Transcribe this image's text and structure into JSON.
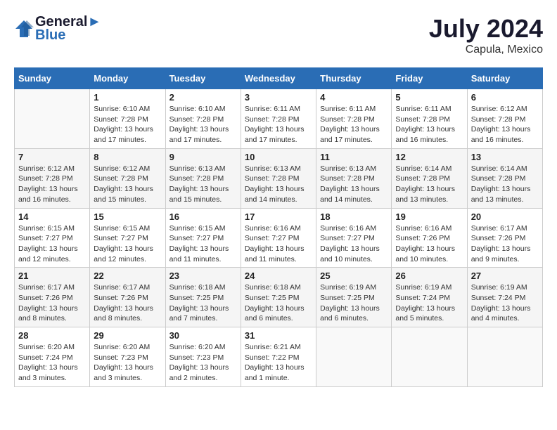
{
  "header": {
    "logo_line1": "General",
    "logo_line2": "Blue",
    "month_year": "July 2024",
    "location": "Capula, Mexico"
  },
  "weekdays": [
    "Sunday",
    "Monday",
    "Tuesday",
    "Wednesday",
    "Thursday",
    "Friday",
    "Saturday"
  ],
  "weeks": [
    [
      {
        "day": "",
        "info": ""
      },
      {
        "day": "1",
        "info": "Sunrise: 6:10 AM\nSunset: 7:28 PM\nDaylight: 13 hours\nand 17 minutes."
      },
      {
        "day": "2",
        "info": "Sunrise: 6:10 AM\nSunset: 7:28 PM\nDaylight: 13 hours\nand 17 minutes."
      },
      {
        "day": "3",
        "info": "Sunrise: 6:11 AM\nSunset: 7:28 PM\nDaylight: 13 hours\nand 17 minutes."
      },
      {
        "day": "4",
        "info": "Sunrise: 6:11 AM\nSunset: 7:28 PM\nDaylight: 13 hours\nand 17 minutes."
      },
      {
        "day": "5",
        "info": "Sunrise: 6:11 AM\nSunset: 7:28 PM\nDaylight: 13 hours\nand 16 minutes."
      },
      {
        "day": "6",
        "info": "Sunrise: 6:12 AM\nSunset: 7:28 PM\nDaylight: 13 hours\nand 16 minutes."
      }
    ],
    [
      {
        "day": "7",
        "info": "Sunrise: 6:12 AM\nSunset: 7:28 PM\nDaylight: 13 hours\nand 16 minutes."
      },
      {
        "day": "8",
        "info": "Sunrise: 6:12 AM\nSunset: 7:28 PM\nDaylight: 13 hours\nand 15 minutes."
      },
      {
        "day": "9",
        "info": "Sunrise: 6:13 AM\nSunset: 7:28 PM\nDaylight: 13 hours\nand 15 minutes."
      },
      {
        "day": "10",
        "info": "Sunrise: 6:13 AM\nSunset: 7:28 PM\nDaylight: 13 hours\nand 14 minutes."
      },
      {
        "day": "11",
        "info": "Sunrise: 6:13 AM\nSunset: 7:28 PM\nDaylight: 13 hours\nand 14 minutes."
      },
      {
        "day": "12",
        "info": "Sunrise: 6:14 AM\nSunset: 7:28 PM\nDaylight: 13 hours\nand 13 minutes."
      },
      {
        "day": "13",
        "info": "Sunrise: 6:14 AM\nSunset: 7:28 PM\nDaylight: 13 hours\nand 13 minutes."
      }
    ],
    [
      {
        "day": "14",
        "info": "Sunrise: 6:15 AM\nSunset: 7:27 PM\nDaylight: 13 hours\nand 12 minutes."
      },
      {
        "day": "15",
        "info": "Sunrise: 6:15 AM\nSunset: 7:27 PM\nDaylight: 13 hours\nand 12 minutes."
      },
      {
        "day": "16",
        "info": "Sunrise: 6:15 AM\nSunset: 7:27 PM\nDaylight: 13 hours\nand 11 minutes."
      },
      {
        "day": "17",
        "info": "Sunrise: 6:16 AM\nSunset: 7:27 PM\nDaylight: 13 hours\nand 11 minutes."
      },
      {
        "day": "18",
        "info": "Sunrise: 6:16 AM\nSunset: 7:27 PM\nDaylight: 13 hours\nand 10 minutes."
      },
      {
        "day": "19",
        "info": "Sunrise: 6:16 AM\nSunset: 7:26 PM\nDaylight: 13 hours\nand 10 minutes."
      },
      {
        "day": "20",
        "info": "Sunrise: 6:17 AM\nSunset: 7:26 PM\nDaylight: 13 hours\nand 9 minutes."
      }
    ],
    [
      {
        "day": "21",
        "info": "Sunrise: 6:17 AM\nSunset: 7:26 PM\nDaylight: 13 hours\nand 8 minutes."
      },
      {
        "day": "22",
        "info": "Sunrise: 6:17 AM\nSunset: 7:26 PM\nDaylight: 13 hours\nand 8 minutes."
      },
      {
        "day": "23",
        "info": "Sunrise: 6:18 AM\nSunset: 7:25 PM\nDaylight: 13 hours\nand 7 minutes."
      },
      {
        "day": "24",
        "info": "Sunrise: 6:18 AM\nSunset: 7:25 PM\nDaylight: 13 hours\nand 6 minutes."
      },
      {
        "day": "25",
        "info": "Sunrise: 6:19 AM\nSunset: 7:25 PM\nDaylight: 13 hours\nand 6 minutes."
      },
      {
        "day": "26",
        "info": "Sunrise: 6:19 AM\nSunset: 7:24 PM\nDaylight: 13 hours\nand 5 minutes."
      },
      {
        "day": "27",
        "info": "Sunrise: 6:19 AM\nSunset: 7:24 PM\nDaylight: 13 hours\nand 4 minutes."
      }
    ],
    [
      {
        "day": "28",
        "info": "Sunrise: 6:20 AM\nSunset: 7:24 PM\nDaylight: 13 hours\nand 3 minutes."
      },
      {
        "day": "29",
        "info": "Sunrise: 6:20 AM\nSunset: 7:23 PM\nDaylight: 13 hours\nand 3 minutes."
      },
      {
        "day": "30",
        "info": "Sunrise: 6:20 AM\nSunset: 7:23 PM\nDaylight: 13 hours\nand 2 minutes."
      },
      {
        "day": "31",
        "info": "Sunrise: 6:21 AM\nSunset: 7:22 PM\nDaylight: 13 hours\nand 1 minute."
      },
      {
        "day": "",
        "info": ""
      },
      {
        "day": "",
        "info": ""
      },
      {
        "day": "",
        "info": ""
      }
    ]
  ]
}
